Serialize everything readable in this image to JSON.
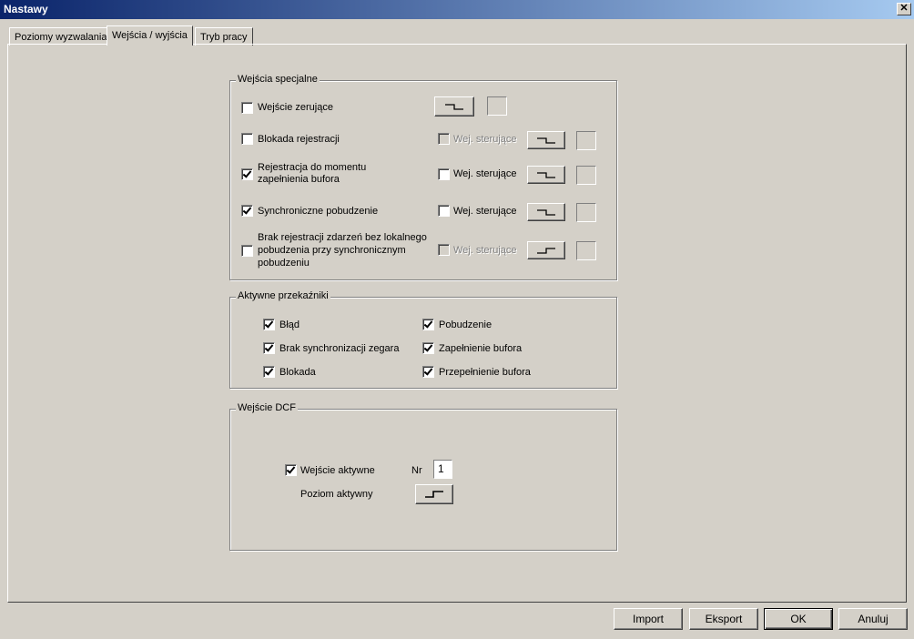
{
  "window": {
    "title": "Nastawy",
    "close_label": "✕"
  },
  "tabs": [
    {
      "label": "Poziomy wyzwalania"
    },
    {
      "label": "Wejścia / wyjścia"
    },
    {
      "label": "Tryb pracy"
    }
  ],
  "special_inputs": {
    "title": "Wejścia specjalne",
    "rows": [
      {
        "label": "Wejście zerujące",
        "checked": false,
        "control_label": "",
        "control_checked": false,
        "control_enabled": false,
        "edge": "falling"
      },
      {
        "label": "Blokada rejestracji",
        "checked": false,
        "control_label": "Wej. sterujące",
        "control_checked": false,
        "control_enabled": false,
        "edge": "falling"
      },
      {
        "label_line1": "Rejestracja do momentu",
        "label_line2": "zapełnienia bufora",
        "checked": true,
        "control_label": "Wej. sterujące",
        "control_checked": false,
        "control_enabled": true,
        "edge": "falling"
      },
      {
        "label": "Synchroniczne pobudzenie",
        "checked": true,
        "control_label": "Wej. sterujące",
        "control_checked": false,
        "control_enabled": true,
        "edge": "falling"
      },
      {
        "label_line1": "Brak rejestracji zdarzeń bez lokalnego",
        "label_line2": "pobudzenia przy synchronicznym",
        "label_line3": "pobudzeniu",
        "checked": false,
        "control_label": "Wej. sterujące",
        "control_checked": false,
        "control_enabled": false,
        "edge": "rising"
      }
    ]
  },
  "relays": {
    "title": "Aktywne przekaźniki",
    "items": [
      {
        "label": "Błąd",
        "checked": true
      },
      {
        "label": "Pobudzenie",
        "checked": true
      },
      {
        "label": "Brak synchronizacji zegara",
        "checked": true
      },
      {
        "label": "Zapełnienie bufora",
        "checked": true
      },
      {
        "label": "Blokada",
        "checked": true
      },
      {
        "label": "Przepełnienie bufora",
        "checked": true
      }
    ]
  },
  "dcf": {
    "title": "Wejście DCF",
    "active_label": "Wejście aktywne",
    "active_checked": true,
    "nr_label": "Nr",
    "nr_value": "1",
    "level_label": "Poziom aktywny",
    "level_edge": "rising"
  },
  "buttons": {
    "import": "Import",
    "export": "Eksport",
    "ok": "OK",
    "cancel": "Anuluj"
  }
}
